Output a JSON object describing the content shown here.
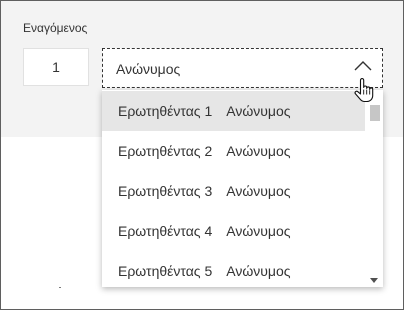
{
  "field": {
    "label": "Εναγόμενος",
    "number_value": "1",
    "dropdown_value": "Ανώνυμος"
  },
  "options": [
    {
      "prefix": "Ερωτηθέντας 1",
      "suffix": "Ανώνυμος",
      "selected": true
    },
    {
      "prefix": "Ερωτηθέντας 2",
      "suffix": "Ανώνυμος",
      "selected": false
    },
    {
      "prefix": "Ερωτηθέντας 3",
      "suffix": "Ανώνυμος",
      "selected": false
    },
    {
      "prefix": "Ερωτηθέντας 4",
      "suffix": "Ανώνυμος",
      "selected": false
    },
    {
      "prefix": "Ερωτηθέντας 5",
      "suffix": "Ανώνυμος",
      "selected": false
    }
  ],
  "icons": {
    "dropdown": "chevron-up-icon",
    "cursor": "hand-pointer-icon"
  }
}
